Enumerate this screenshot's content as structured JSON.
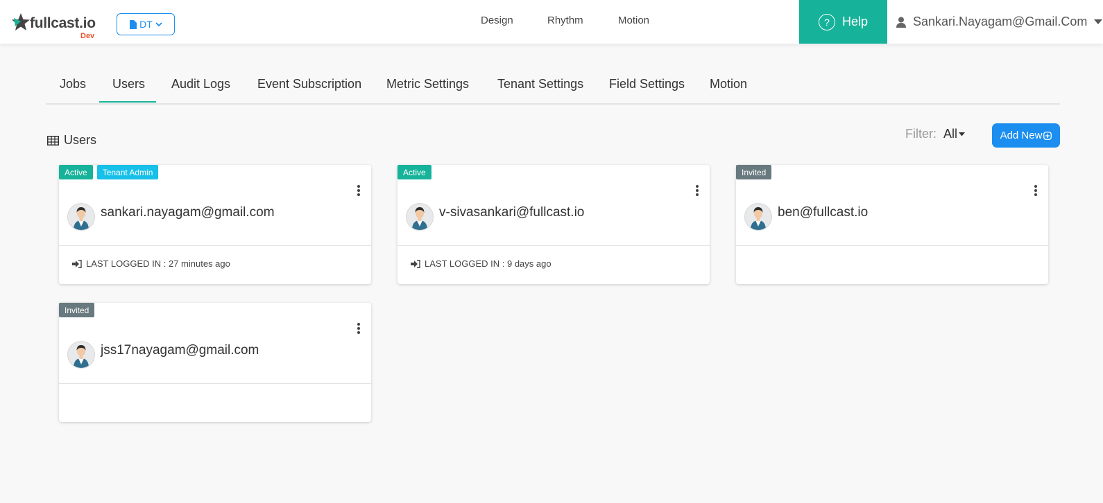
{
  "header": {
    "brand": "fullcast.io",
    "env": "Dev",
    "workspace": "DT",
    "nav": [
      "Design",
      "Rhythm",
      "Motion"
    ],
    "help": "Help",
    "user": "Sankari.Nayagam@Gmail.Com"
  },
  "tabs": [
    "Jobs",
    "Users",
    "Audit Logs",
    "Event Subscription",
    "Metric Settings",
    "Tenant Settings",
    "Field Settings",
    "Motion"
  ],
  "active_tab": "Users",
  "section": {
    "title": "Users",
    "filter_label": "Filter:",
    "filter_value": "All",
    "add_button": "Add New"
  },
  "users": [
    {
      "email": "sankari.nayagam@gmail.com",
      "badges": [
        "Active",
        "Tenant Admin"
      ],
      "last_label": "LAST LOGGED IN :",
      "last_value": "27 minutes ago"
    },
    {
      "email": "v-sivasankari@fullcast.io",
      "badges": [
        "Active"
      ],
      "last_label": "LAST LOGGED IN :",
      "last_value": "9 days ago"
    },
    {
      "email": "ben@fullcast.io",
      "badges": [
        "Invited"
      ],
      "last_label": "",
      "last_value": ""
    },
    {
      "email": "jss17nayagam@gmail.com",
      "badges": [
        "Invited"
      ],
      "last_label": "",
      "last_value": ""
    }
  ],
  "colors": {
    "accent": "#16b39a",
    "primary": "#1b8ef0",
    "info": "#17c0e8",
    "muted": "#68797f"
  },
  "icons": [
    "logo-star-icon",
    "file-icon",
    "chevron-down-icon",
    "help-icon",
    "user-icon",
    "caret-down-icon",
    "table-icon",
    "add-circle-icon",
    "kebab-icon",
    "avatar-icon",
    "sign-in-icon"
  ]
}
